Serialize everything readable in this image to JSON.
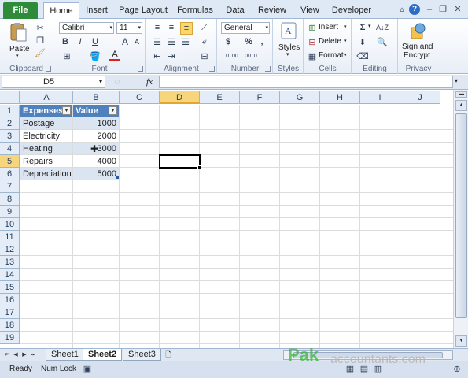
{
  "tabs": {
    "file": "File",
    "items": [
      "Home",
      "Insert",
      "Page Layout",
      "Formulas",
      "Data",
      "Review",
      "View",
      "Developer"
    ],
    "active": "Home"
  },
  "ribbon": {
    "clipboard": {
      "label": "Clipboard",
      "paste": "Paste"
    },
    "font": {
      "label": "Font",
      "name": "Calibri",
      "size": "11",
      "bold": "B",
      "italic": "I",
      "underline": "U",
      "grow": "A",
      "shrink": "A",
      "color_a": "A"
    },
    "alignment": {
      "label": "Alignment"
    },
    "number": {
      "label": "Number",
      "format": "General",
      "currency": "$",
      "percent": "%",
      "comma": ",",
      "inc_decimal": ".0 .00",
      "dec_decimal": ".00 .0"
    },
    "styles": {
      "label": "Styles",
      "button": "Styles"
    },
    "cells": {
      "label": "Cells",
      "insert": "Insert",
      "delete": "Delete",
      "format": "Format"
    },
    "editing": {
      "label": "Editing"
    },
    "privacy": {
      "label": "Privacy",
      "sign_line1": "Sign and",
      "sign_line2": "Encrypt"
    }
  },
  "formula_bar": {
    "name_box": "D5",
    "fx": "fx",
    "value": ""
  },
  "grid": {
    "columns": [
      "A",
      "B",
      "C",
      "D",
      "E",
      "F",
      "G",
      "H",
      "I",
      "J"
    ],
    "rows": [
      "1",
      "2",
      "3",
      "4",
      "5",
      "6",
      "7",
      "8",
      "9",
      "10",
      "11",
      "12",
      "13",
      "14",
      "15",
      "16",
      "17",
      "18",
      "19"
    ],
    "selected_column": "D",
    "selected_row": "5",
    "table": {
      "header": [
        "Expenses",
        "Value"
      ],
      "rows": [
        [
          "Postage",
          "1000"
        ],
        [
          "Electricity",
          "2000"
        ],
        [
          "Heating",
          "3000"
        ],
        [
          "Repairs",
          "4000"
        ],
        [
          "Depreciation",
          "5000"
        ]
      ]
    }
  },
  "sheets": {
    "items": [
      "Sheet1",
      "Sheet2",
      "Sheet3"
    ],
    "active": "Sheet2"
  },
  "status": {
    "ready": "Ready",
    "numlock": "Num Lock"
  },
  "watermark": {
    "brand": "Pak",
    "site": "accountants.com"
  },
  "colors": {
    "table_header": "#4f81bd",
    "band": "#dbe5f1",
    "file_tab": "#2e8b3a",
    "selection_header": "#f7d57d"
  }
}
